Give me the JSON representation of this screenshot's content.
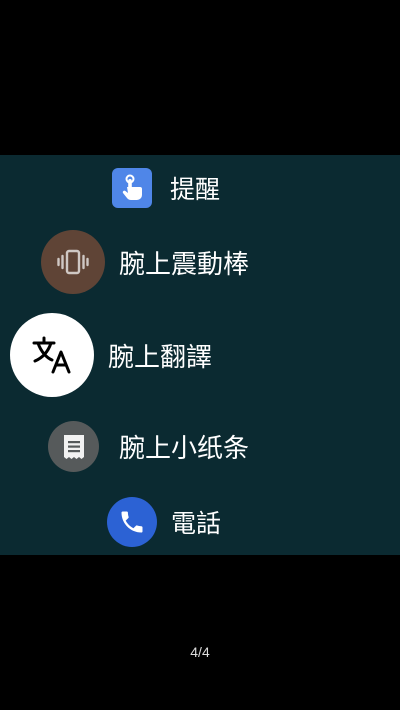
{
  "apps": [
    {
      "label": "提醒",
      "icon": "reminder-hand-icon",
      "color": "#4f86e8"
    },
    {
      "label": "腕上震動棒",
      "icon": "vibrate-icon",
      "color": "#5f4436"
    },
    {
      "label": "腕上翻譯",
      "icon": "translate-icon",
      "color": "#ffffff",
      "selected": true
    },
    {
      "label": "腕上小纸条",
      "icon": "note-icon",
      "color": "#565a5b"
    },
    {
      "label": "電話",
      "icon": "phone-icon",
      "color": "#2c62d4"
    }
  ],
  "pager": {
    "text": "4/4"
  },
  "colors": {
    "background": "#000000",
    "panel": "#0b2a31"
  }
}
